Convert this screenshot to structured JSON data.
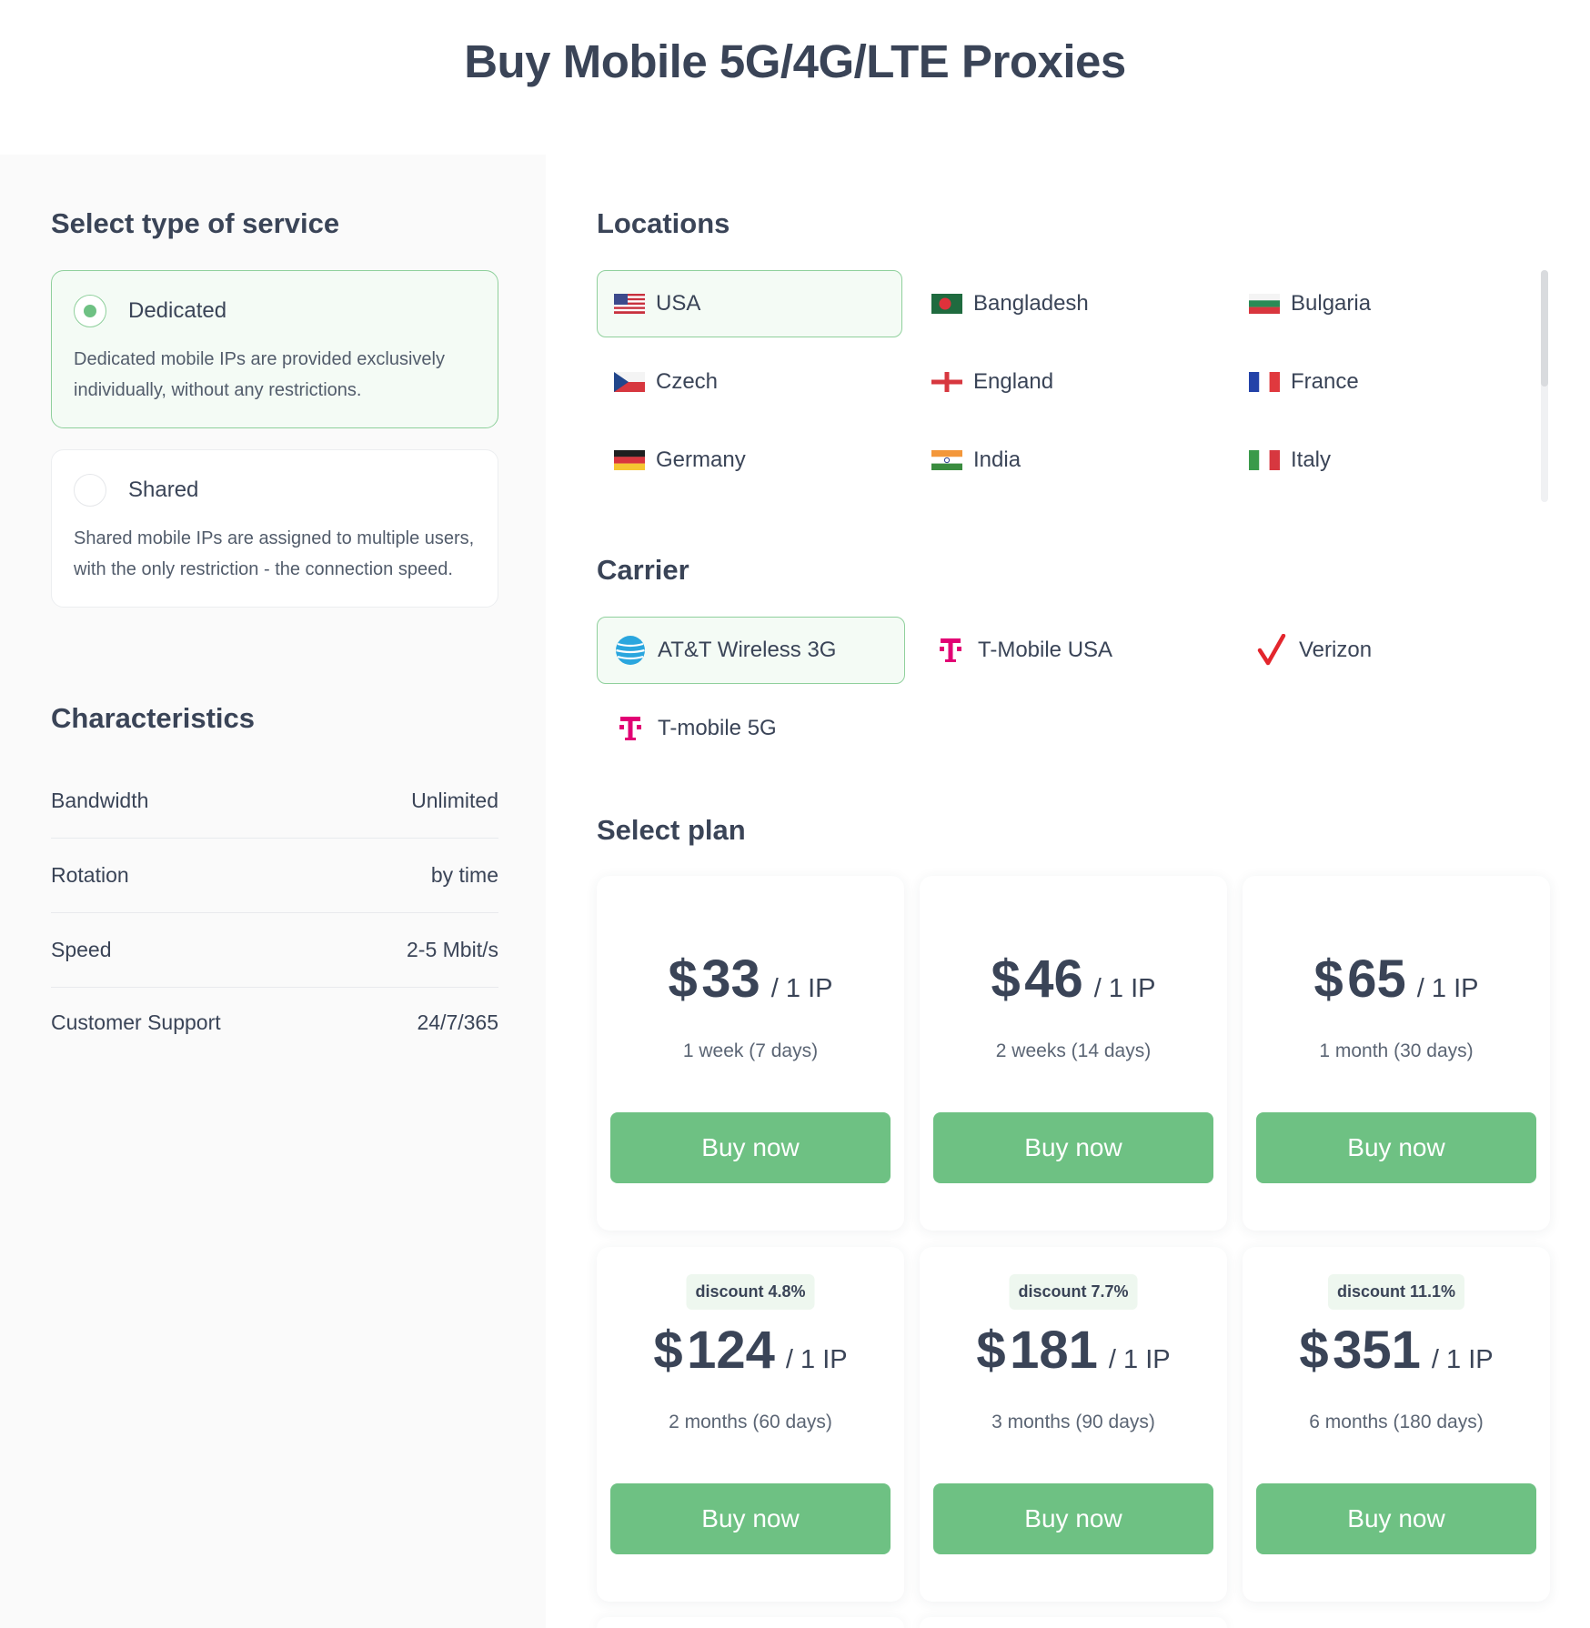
{
  "page": {
    "title": "Buy Mobile 5G/4G/LTE Proxies"
  },
  "service": {
    "title": "Select type of service",
    "options": [
      {
        "name": "Dedicated",
        "description": "Dedicated mobile IPs are provided exclusively individually, without any restrictions.",
        "selected": true
      },
      {
        "name": "Shared",
        "description": "Shared mobile IPs are assigned to multiple users, with the only restriction - the connection speed.",
        "selected": false
      }
    ]
  },
  "characteristics": {
    "title": "Characteristics",
    "rows": [
      {
        "label": "Bandwidth",
        "value": "Unlimited"
      },
      {
        "label": "Rotation",
        "value": "by time"
      },
      {
        "label": "Speed",
        "value": "2-5 Mbit/s"
      },
      {
        "label": "Customer Support",
        "value": "24/7/365"
      }
    ]
  },
  "locations": {
    "title": "Locations",
    "items": [
      {
        "name": "USA",
        "icon": "us-flag-icon",
        "selected": true
      },
      {
        "name": "Bangladesh",
        "icon": "bangladesh-flag-icon",
        "selected": false
      },
      {
        "name": "Bulgaria",
        "icon": "bulgaria-flag-icon",
        "selected": false
      },
      {
        "name": "Czech",
        "icon": "czech-flag-icon",
        "selected": false
      },
      {
        "name": "England",
        "icon": "england-flag-icon",
        "selected": false
      },
      {
        "name": "France",
        "icon": "france-flag-icon",
        "selected": false
      },
      {
        "name": "Germany",
        "icon": "germany-flag-icon",
        "selected": false
      },
      {
        "name": "India",
        "icon": "india-flag-icon",
        "selected": false
      },
      {
        "name": "Italy",
        "icon": "italy-flag-icon",
        "selected": false
      }
    ]
  },
  "carrier": {
    "title": "Carrier",
    "items": [
      {
        "name": "AT&T Wireless 3G",
        "icon": "att-globe-icon",
        "selected": true
      },
      {
        "name": "T-Mobile USA",
        "icon": "t-mobile-icon",
        "selected": false
      },
      {
        "name": "Verizon",
        "icon": "verizon-check-icon",
        "selected": false
      },
      {
        "name": "T-mobile 5G",
        "icon": "t-mobile-icon",
        "selected": false
      }
    ]
  },
  "plans": {
    "title": "Select plan",
    "buy_label": "Buy now",
    "items": [
      {
        "currency": "$",
        "amount": "33",
        "unit": "/ 1 IP",
        "period": "1 week (7 days)",
        "discount": ""
      },
      {
        "currency": "$",
        "amount": "46",
        "unit": "/ 1 IP",
        "period": "2 weeks (14 days)",
        "discount": ""
      },
      {
        "currency": "$",
        "amount": "65",
        "unit": "/ 1 IP",
        "period": "1 month (30 days)",
        "discount": ""
      },
      {
        "currency": "$",
        "amount": "124",
        "unit": "/ 1 IP",
        "period": "2 months (60 days)",
        "discount": "discount 4.8%"
      },
      {
        "currency": "$",
        "amount": "181",
        "unit": "/ 1 IP",
        "period": "3 months (90 days)",
        "discount": "discount 7.7%"
      },
      {
        "currency": "$",
        "amount": "351",
        "unit": "/ 1 IP",
        "period": "6 months (180 days)",
        "discount": "discount 11.1%"
      }
    ]
  },
  "colors": {
    "accent": "#6ec183",
    "selected_bg": "#f4fbf5",
    "selected_border": "#8fd09c",
    "text": "#3a4457"
  }
}
